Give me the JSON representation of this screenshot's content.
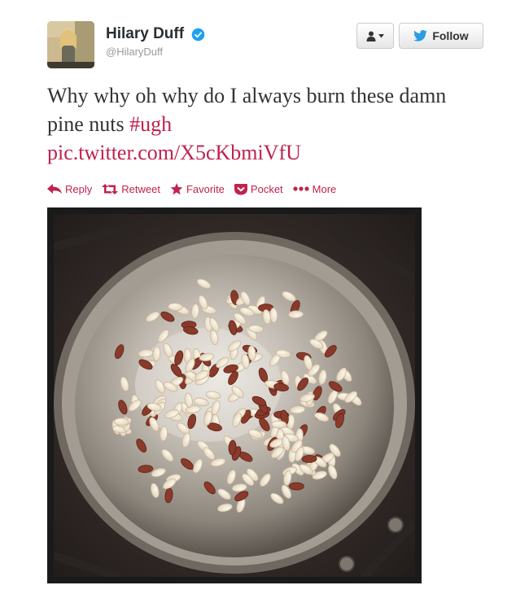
{
  "user": {
    "display_name": "Hilary Duff",
    "screen_name": "@HilaryDuff",
    "verified": true
  },
  "header_buttons": {
    "user_menu_icon": "user-dropdown-icon",
    "follow_label": "Follow"
  },
  "tweet": {
    "text_line": "Why why oh why do I always burn these damn pine nuts ",
    "hashtag": "#ugh",
    "link": "pic.twitter.com/X5cKbmiVfU"
  },
  "actions": [
    {
      "icon": "reply-icon",
      "label": "Reply"
    },
    {
      "icon": "retweet-icon",
      "label": "Retweet"
    },
    {
      "icon": "star-icon",
      "label": "Favorite"
    },
    {
      "icon": "pocket-icon",
      "label": "Pocket"
    },
    {
      "icon": "more-dots-icon",
      "label": "More"
    }
  ],
  "colors": {
    "link": "#c0224d",
    "verified": "#1da1f2",
    "twitter_bird": "#2b9de2"
  }
}
